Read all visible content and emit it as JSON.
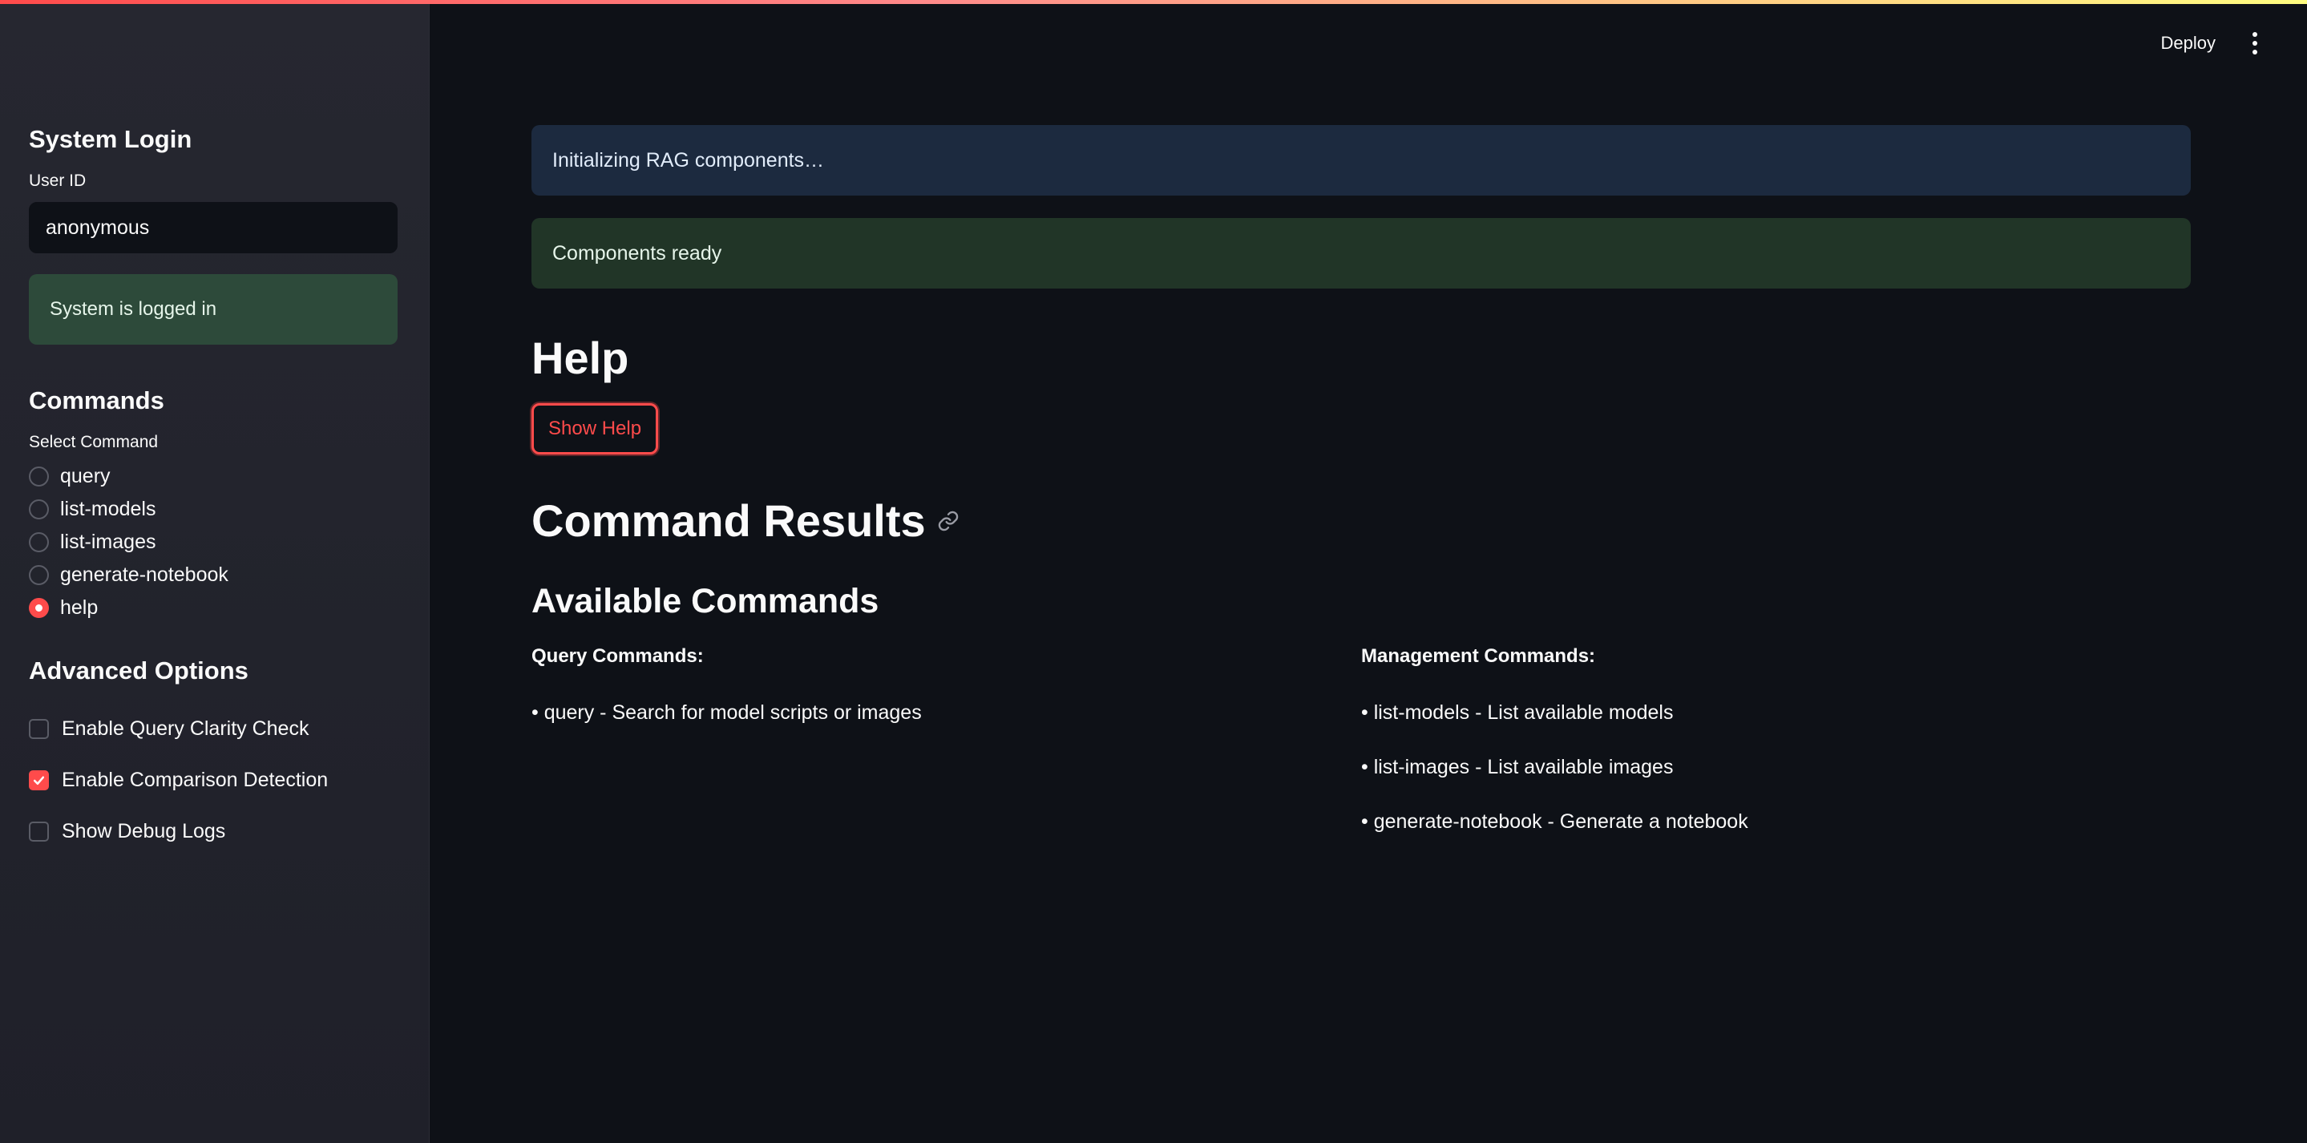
{
  "header": {
    "deploy_label": "Deploy"
  },
  "sidebar": {
    "login_title": "System Login",
    "user_id_label": "User ID",
    "user_id_value": "anonymous",
    "login_status": "System is logged in",
    "commands_title": "Commands",
    "select_command_label": "Select Command",
    "commands": [
      {
        "label": "query",
        "selected": false
      },
      {
        "label": "list-models",
        "selected": false
      },
      {
        "label": "list-images",
        "selected": false
      },
      {
        "label": "generate-notebook",
        "selected": false
      },
      {
        "label": "help",
        "selected": true
      }
    ],
    "advanced_title": "Advanced Options",
    "options": [
      {
        "label": "Enable Query Clarity Check",
        "checked": false
      },
      {
        "label": "Enable Comparison Detection",
        "checked": true
      },
      {
        "label": "Show Debug Logs",
        "checked": false
      }
    ]
  },
  "main": {
    "info_message": "Initializing RAG components…",
    "ready_message": "Components ready",
    "help_heading": "Help",
    "show_help_button": "Show Help",
    "results_heading": "Command Results",
    "available_heading": "Available Commands",
    "query_commands": {
      "title": "Query Commands:",
      "items": [
        "• query - Search for model scripts or images"
      ]
    },
    "management_commands": {
      "title": "Management Commands:",
      "items": [
        "• list-models - List available models",
        "• list-images - List available images",
        "• generate-notebook - Generate a notebook"
      ]
    }
  },
  "colors": {
    "accent": "#ff4b4b",
    "background": "#0e1117",
    "sidebar_bg": "#262730",
    "info_bg": "#1c2a3f",
    "success_bg": "#213527"
  },
  "icons": {
    "menu": "vertical-ellipsis-icon",
    "link": "link-icon",
    "check": "checkmark-icon"
  }
}
